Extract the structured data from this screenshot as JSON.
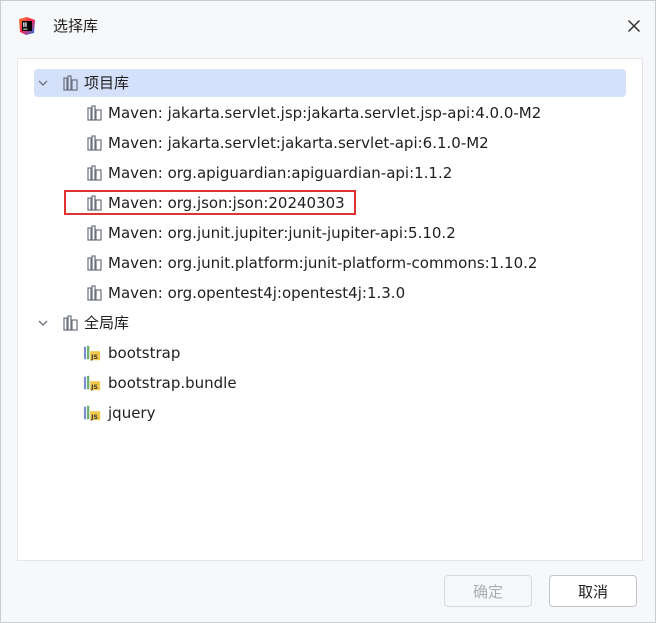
{
  "window": {
    "title": "选择库",
    "app_icon": "intellij-idea-icon",
    "close_icon": "close-icon"
  },
  "tree": {
    "groups": [
      {
        "label": "项目库",
        "expanded": true,
        "selected": true,
        "items": [
          {
            "label": "Maven: jakarta.servlet.jsp:jakarta.servlet.jsp-api:4.0.0-M2",
            "icon": "library-icon"
          },
          {
            "label": "Maven: jakarta.servlet:jakarta.servlet-api:6.1.0-M2",
            "icon": "library-icon"
          },
          {
            "label": "Maven: org.apiguardian:apiguardian-api:1.1.2",
            "icon": "library-icon"
          },
          {
            "label": "Maven: org.json:json:20240303",
            "icon": "library-icon",
            "annotated": true
          },
          {
            "label": "Maven: org.junit.jupiter:junit-jupiter-api:5.10.2",
            "icon": "library-icon"
          },
          {
            "label": "Maven: org.junit.platform:junit-platform-commons:1.10.2",
            "icon": "library-icon"
          },
          {
            "label": "Maven: org.opentest4j:opentest4j:1.3.0",
            "icon": "library-icon"
          }
        ]
      },
      {
        "label": "全局库",
        "expanded": true,
        "selected": false,
        "items": [
          {
            "label": "bootstrap",
            "icon": "js-library-icon"
          },
          {
            "label": "bootstrap.bundle",
            "icon": "js-library-icon"
          },
          {
            "label": "jquery",
            "icon": "js-library-icon"
          }
        ]
      }
    ]
  },
  "buttons": {
    "ok_label": "确定",
    "ok_enabled": false,
    "cancel_label": "取消"
  },
  "colors": {
    "selection": "#d5e1fb",
    "annotation_box": "#e0322f",
    "disabled_text": "#a9acb3"
  }
}
